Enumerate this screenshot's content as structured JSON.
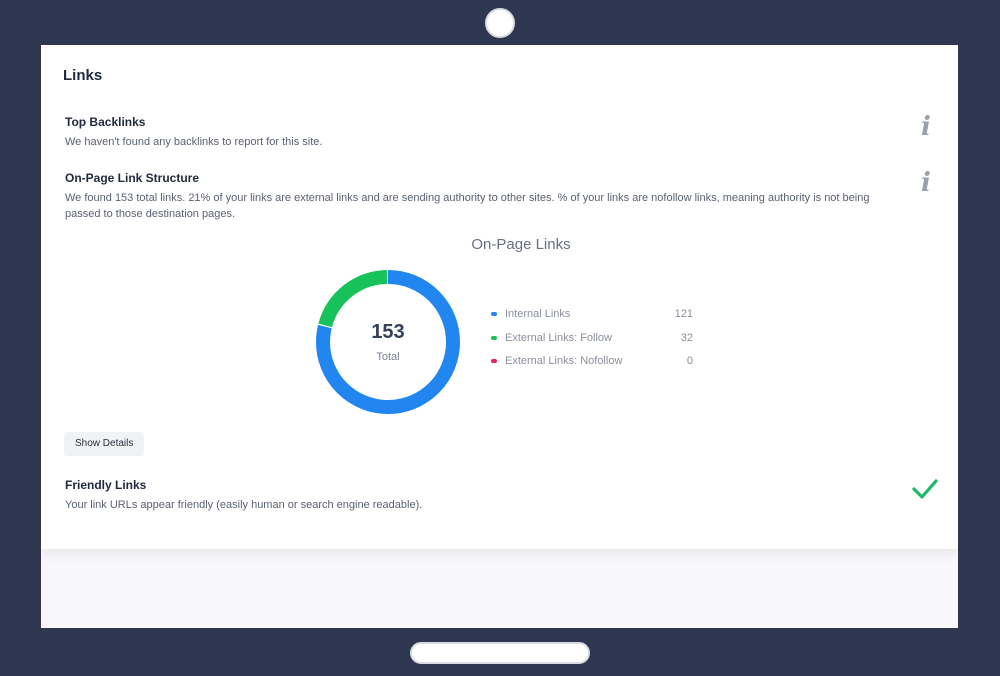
{
  "section": {
    "title": "Links"
  },
  "top_backlinks": {
    "title": "Top Backlinks",
    "description": "We haven't found any backlinks to report for this site.",
    "icon": "info-icon"
  },
  "link_structure": {
    "title": "On-Page Link Structure",
    "description": "We found 153 total links. 21% of your links are external links and are sending authority to other sites. % of your links are nofollow links, meaning authority is not being passed to those destination pages.",
    "icon": "info-icon",
    "show_details_label": "Show Details"
  },
  "chart_data": {
    "type": "pie",
    "title": "On-Page Links",
    "center_value": "153",
    "center_label": "Total",
    "categories": [
      "Internal Links",
      "External Links: Follow",
      "External Links: Nofollow"
    ],
    "values": [
      121,
      32,
      0
    ],
    "colors": [
      "#2186f0",
      "#18c25a",
      "#e8245a"
    ],
    "legend_position": "right"
  },
  "friendly_links": {
    "title": "Friendly Links",
    "description": "Your link URLs appear friendly (easily human or search engine readable).",
    "icon": "checkmark-icon",
    "status_color": "#1fb866"
  }
}
